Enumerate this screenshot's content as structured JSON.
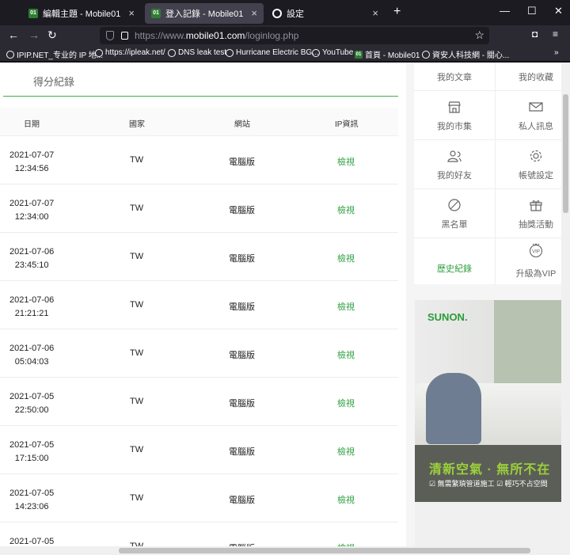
{
  "browser": {
    "tabs": [
      {
        "label": "編輯主題 - Mobile01",
        "favicon": "01"
      },
      {
        "label": "登入記錄 - Mobile01",
        "favicon": "01"
      },
      {
        "label": "設定"
      }
    ],
    "url_prefix": "https://www.",
    "url_domain": "mobile01.com",
    "url_path": "/loginlog.php",
    "bookmarks": [
      "IPIP.NET_专业的 IP 地...",
      "https://ipleak.net/",
      "DNS leak test",
      "Hurricane Electric BG...",
      "YouTube",
      "首頁 - Mobile01",
      "資安人科技網 - 關心..."
    ]
  },
  "section_title": "得分紀錄",
  "table": {
    "headers": [
      "日期",
      "國家",
      "網站",
      "IP資訊"
    ],
    "rows": [
      {
        "date": "2021-07-07",
        "time": "12:34:56",
        "country": "TW",
        "site": "電腦版",
        "ip": "檢視"
      },
      {
        "date": "2021-07-07",
        "time": "12:34:00",
        "country": "TW",
        "site": "電腦版",
        "ip": "檢視"
      },
      {
        "date": "2021-07-06",
        "time": "23:45:10",
        "country": "TW",
        "site": "電腦版",
        "ip": "檢視"
      },
      {
        "date": "2021-07-06",
        "time": "21:21:21",
        "country": "TW",
        "site": "電腦版",
        "ip": "檢視"
      },
      {
        "date": "2021-07-06",
        "time": "05:04:03",
        "country": "TW",
        "site": "電腦版",
        "ip": "檢視"
      },
      {
        "date": "2021-07-05",
        "time": "22:50:00",
        "country": "TW",
        "site": "電腦版",
        "ip": "檢視"
      },
      {
        "date": "2021-07-05",
        "time": "17:15:00",
        "country": "TW",
        "site": "電腦版",
        "ip": "檢視"
      },
      {
        "date": "2021-07-05",
        "time": "14:23:06",
        "country": "TW",
        "site": "電腦版",
        "ip": "檢視"
      },
      {
        "date": "2021-07-05",
        "time": "",
        "country": "TW",
        "site": "電腦版",
        "ip": "檢視"
      }
    ]
  },
  "sidebar_menu": [
    {
      "label": "我的文章",
      "icon": "article-icon"
    },
    {
      "label": "我的收藏",
      "icon": "bookmark-icon"
    },
    {
      "label": "我的市集",
      "icon": "store-icon"
    },
    {
      "label": "私人訊息",
      "icon": "mail-icon"
    },
    {
      "label": "我的好友",
      "icon": "friends-icon"
    },
    {
      "label": "帳號設定",
      "icon": "gear-icon"
    },
    {
      "label": "黑名單",
      "icon": "block-icon"
    },
    {
      "label": "抽獎活動",
      "icon": "gift-icon"
    },
    {
      "label": "歷史紀錄",
      "icon": ""
    },
    {
      "label": "升級為VIP",
      "icon": "vip-icon"
    }
  ],
  "ad": {
    "brand": "SUNON.",
    "slogan": "清新空氣 · 無所不在",
    "points": "☑ 無需繁瑣管道施工 ☑ 輕巧不占空間"
  },
  "colors": {
    "accent": "#2e9f3f",
    "divider_green": "#3cb24a",
    "browser_dark": "#1c1b22"
  }
}
